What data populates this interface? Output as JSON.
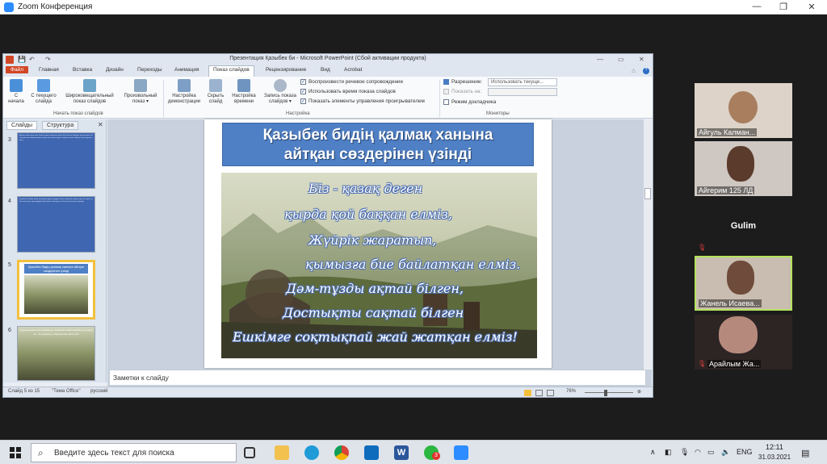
{
  "zoom": {
    "title": "Zoom Конференция",
    "minimize": "—",
    "maximize": "❐",
    "close": "✕"
  },
  "ppt": {
    "title": "Презентация Қазыбек би  -  Microsoft PowerPoint (Сбой активации продукта)",
    "tabs": [
      "Файл",
      "Главная",
      "Вставка",
      "Дизайн",
      "Переходы",
      "Анимация",
      "Показ слайдов",
      "Рецензирование",
      "Вид",
      "Acrobat"
    ],
    "ribbon": {
      "buttons": [
        {
          "label": "С\nначала"
        },
        {
          "label": "С текущего\nслайда"
        },
        {
          "label": "Широковещательный\nпоказ слайдов"
        },
        {
          "label": "Произвольный\nпоказ ▾"
        },
        {
          "label": "Настройка\nдемонстрации"
        },
        {
          "label": "Скрыть\nслайд"
        },
        {
          "label": "Настройка\nвремени"
        },
        {
          "label": "Запись показа\nслайдов ▾"
        }
      ],
      "groups": [
        "Начать показ слайдов",
        "Настройка",
        "Мониторы"
      ],
      "checks": [
        {
          "label": "Воспроизвести речевое сопровождение",
          "checked": true
        },
        {
          "label": "Использовать время показа слайдов",
          "checked": true
        },
        {
          "label": "Показать элементы управления проигрывателем",
          "checked": true
        }
      ],
      "resolution_label": "Разрешение:",
      "resolution_value": "Использовать текуще...",
      "show_on_label": "Показать на:",
      "presenter_mode": "Режим докладчика"
    },
    "panel_tabs": [
      "Слайды",
      "Структура"
    ],
    "thumbs": [
      {
        "num": "3",
        "text": "Айтуға жеңіл айту үшін болған адам тарихтың үлкен бір белесін біріндеп жатыр қарап ойлау үшін көп ойлану керек сияқты сөз болып тұрған сияқты болып сөйлеу болып тұрған кезең"
      },
      {
        "num": "4",
        "text": "Қазыбек би бүкіл қазақ халқының мұңын мұңдап жоғын жоқтаған тарихи тұлға ел үшін еңбек еткен ұлы тұлғалардың бірі болып саналады ел басына күн туған заманда"
      },
      {
        "num": "5",
        "title": "Қазыбек бидің қалмақ ханына айтқан сөздерінен үзінді"
      },
      {
        "num": "6",
        "text": "Жұртымызды ала алмайсың, Жерімізді шаба алмайсың, Атаңнан - да қалмаған, Жайымызды біліп қой!"
      }
    ],
    "slide": {
      "title_line1": "Қазыбек бидің қалмақ ханына",
      "title_line2": "айтқан сөздерінен үзінді",
      "poem": [
        "Біз - қазақ деген",
        "қырда қой баққан елміз,",
        "Жүйрік жаратып,",
        "қымызға бие байлатқан елміз.",
        "Дәм-тұзды ақтай білген,",
        "Достықты сақтай білген",
        "Ешкімге соқтықпай жай жатқан елміз!"
      ]
    },
    "notes_placeholder": "Заметки к слайду",
    "status": {
      "slide": "Слайд 5 из 15",
      "theme": "\"Тема Office\"",
      "lang": "русский",
      "zoom": "76%"
    }
  },
  "participants": [
    {
      "name": "Айгуль Калман...",
      "mic_off": false
    },
    {
      "name": "Айгерим 125 ЛД",
      "mic_off": false
    },
    {
      "name": "Gulim",
      "mic_off": true
    },
    {
      "name": "Жанель Исаева...",
      "mic_off": false
    },
    {
      "name": "Арайлым Жа...",
      "mic_off": true
    }
  ],
  "taskbar": {
    "search_placeholder": "Введите здесь текст для поиска",
    "lang": "ENG",
    "time": "12:11",
    "date": "31.03.2021",
    "badge": "3"
  }
}
